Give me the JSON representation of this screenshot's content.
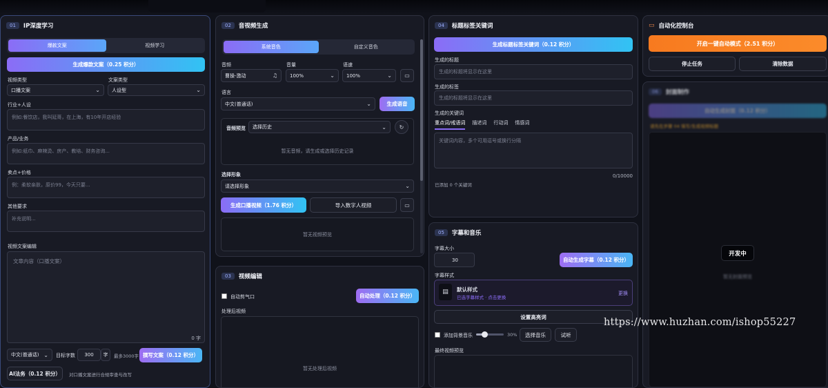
{
  "p1": {
    "num": "01",
    "title": "IP深度学习",
    "tabs": [
      "爆款文案",
      "视频学习"
    ],
    "gen_btn": "生成爆款文案（0.25 积分）",
    "video_type_label": "视频类型",
    "video_type_value": "口播文案",
    "copy_type_label": "文案类型",
    "copy_type_value": "人设型",
    "industry_label": "行业+人设",
    "industry_ph": "例如:餐饮店，我叫延哥，在上海，有10年开店经验",
    "product_label": "产品/业务",
    "product_ph": "例如:纸巾、麻辣烫、房产、教培、财务咨询...",
    "selling_label": "卖点+价格",
    "selling_ph": "例：柔软亲肤，原价99，今天只要...",
    "other_label": "其他要求",
    "other_ph": "补充说明...",
    "editor_label": "视频文案编辑",
    "editor_ph": "文章内容（口播文案）",
    "editor_count": "0 字",
    "lang_value": "中文(普通话)",
    "target_label": "目标字数",
    "target_value": "300",
    "unit": "字",
    "max_note": "最多3000字",
    "rewrite_btn": "撰写文案（0.12 积分）",
    "ai_btn": "AI法务（0.12 积分）",
    "ai_note": "对口播文案进行合规审查与改写"
  },
  "p2": {
    "num": "02",
    "title": "音视频生成",
    "tabs": [
      "系统音色",
      "自定义音色"
    ],
    "timbre_label": "音频",
    "timbre_value": "曹操-激动",
    "volume_label": "音量",
    "volume_value": "100%",
    "speed_label": "语速",
    "speed_value": "100%",
    "lang_label": "语言",
    "lang_value": "中文(普通话)",
    "gen_voice_btn": "生成语音",
    "preview_label": "音频预览",
    "history_value": "选择历史",
    "audio_empty": "暂无音频，请生成或选择历史记录",
    "avatar_label": "选择形象",
    "avatar_value": "请选择形象",
    "gen_video_btn": "生成口播视频（1.76 积分）",
    "import_btn": "导入数字人视频",
    "video_empty": "暂无视频预览"
  },
  "p3": {
    "num": "03",
    "title": "视频编辑",
    "auto_cut_label": "自动剪气口",
    "auto_btn": "自动处理（0.12 积分）",
    "processed_label": "处理后视频",
    "processed_empty": "暂无处理后视频"
  },
  "p4": {
    "num": "04",
    "title": "标题标签关键词",
    "gen_btn": "生成标题标签关键词（0.12 积分）",
    "title_label": "生成的标题",
    "title_ph": "生成的标题将显示在这里",
    "tag_label": "生成的标签",
    "tag_ph": "生成的标题将显示在这里",
    "kw_label": "生成的关键词",
    "kw_tabs": [
      "重点词/戒语词",
      "描述词",
      "行动词",
      "情感词"
    ],
    "kw_ph": "关键词内容，多个可用逗号或换行分隔",
    "kw_count": "0/10000",
    "kw_added": "已添加 0 个关键词"
  },
  "p5": {
    "num": "05",
    "title": "字幕和音乐",
    "size_label": "字幕大小",
    "size_value": "30",
    "auto_sub_btn": "自动生成字幕（0.12 积分）",
    "style_label": "字幕样式",
    "style_name": "默认样式",
    "style_sub": "已选字幕样式 · 点击更换",
    "style_change": "更换",
    "highlight_btn": "设置高亮词",
    "bgm_label": "添加背景音乐",
    "bgm_volume": 30,
    "bgm_volume_text": "30%",
    "choose_music_btn": "选择音乐",
    "listen_btn": "试听",
    "final_label": "最终视频预览"
  },
  "p6": {
    "title": "自动化控制台",
    "auto_btn": "开启一键自动模式（2.51 积分）",
    "stop_btn": "停止任务",
    "clear_btn": "清除数据"
  },
  "p7": {
    "num": "06",
    "title": "封面制作",
    "gen_btn": "自动生成封面（0.12 积分）",
    "note": "请先在步骤 04 填写/生成视频标题",
    "dev": "开发中",
    "empty": "暂无封面预览"
  },
  "watermark": "https://www.huzhan.com/ishop55227"
}
